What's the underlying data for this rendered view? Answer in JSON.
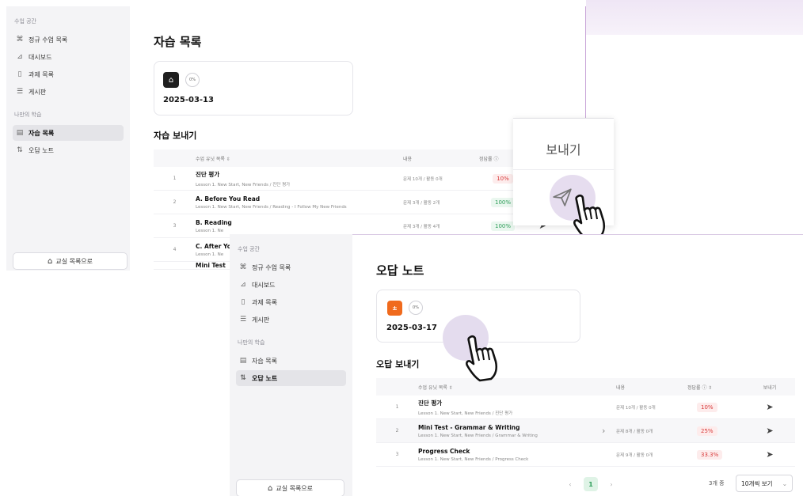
{
  "nav_section_class": "수업 공간",
  "nav_section_mine": "나만의 학습",
  "nav_items": {
    "regular": "정규 수업 목록",
    "dashboard": "대시보드",
    "assignments": "과제 목록",
    "board": "게시판",
    "self_study": "자습 목록",
    "wrong_note": "오답 노트"
  },
  "back_to_classroom": "교실 목록으로",
  "self_study_page": {
    "title": "자습 목록",
    "card_percent": "0%",
    "card_date": "2025-03-13",
    "section_title": "자습 보내기",
    "table_headers": {
      "unit": "수업 유닛 목록 ⇳",
      "content": "내용",
      "accuracy": "정답률 ⓘ"
    },
    "rows": [
      {
        "num": "1",
        "title": "진단 평가",
        "sub": "Lesson 1. New Start, New Friends / 진단 평가",
        "content": "문제 10개 / 활동 0개",
        "pct": "10%",
        "pct_color": "red"
      },
      {
        "num": "2",
        "title": "A. Before You Read",
        "sub": "Lesson 1. New Start, New Friends / Reading - I Follow My New Friends",
        "content": "문제 3개 / 활동 2개",
        "pct": "100%",
        "pct_color": "green"
      },
      {
        "num": "3",
        "title": "B. Reading",
        "sub": "Lesson 1. Ne",
        "content": "문제 3개 / 활동 4개",
        "pct": "100%",
        "pct_color": "green"
      },
      {
        "num": "4",
        "title": "C. After You",
        "sub": "Lesson 1. Ne",
        "content": "",
        "pct": "",
        "pct_color": ""
      }
    ],
    "partial_row_title": "Mini Test"
  },
  "popover": {
    "title": "보내기"
  },
  "wrong_note_page": {
    "title": "오답 노트",
    "card_percent": "0%",
    "card_date": "2025-03-17",
    "section_title": "오답 보내기",
    "table_headers": {
      "unit": "수업 유닛 목록 ⇳",
      "content": "내용",
      "accuracy": "정답률 ⓘ ⇳",
      "send": "보내기"
    },
    "rows": [
      {
        "num": "1",
        "title": "진단 평가",
        "sub": "Lesson 1. New Start, New Friends / 진단 평가",
        "content": "문제 10개 / 활동 0개",
        "pct": "10%",
        "chevron": ""
      },
      {
        "num": "2",
        "title": "Mini Test - Grammar & Writing",
        "sub": "Lesson 1. New Start, New Friends / Grammar & Writing",
        "content": "문제 8개 / 활동 0개",
        "pct": "25%",
        "chevron": "›"
      },
      {
        "num": "3",
        "title": "Progress Check",
        "sub": "Lesson 1. New Start, New Friends / Progress Check",
        "content": "문제 9개 / 활동 0개",
        "pct": "33.3%",
        "chevron": ""
      }
    ],
    "pager": {
      "prev": "‹",
      "current": "1",
      "next": "›"
    },
    "count": "3개 중",
    "per_page": "10개씩 보기"
  },
  "icons": {
    "send": "➤",
    "home": "⌂",
    "cap": "🎓",
    "chevron_down": "⌄"
  }
}
